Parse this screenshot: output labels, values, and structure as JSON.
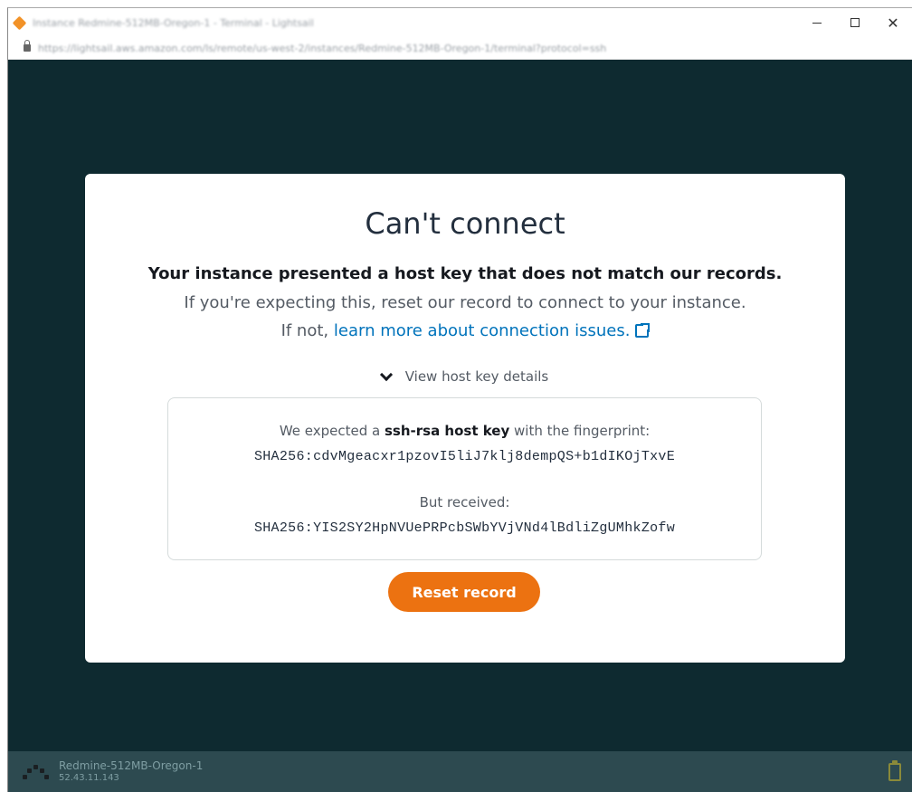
{
  "browser": {
    "title": "Instance Redmine-512MB-Oregon-1 - Terminal - Lightsail",
    "url": "https://lightsail.aws.amazon.com/ls/remote/us-west-2/instances/Redmine-512MB-Oregon-1/terminal?protocol=ssh"
  },
  "window_controls": {
    "minimize": "minimize",
    "maximize": "maximize",
    "close": "✕"
  },
  "dialog": {
    "title": "Can't connect",
    "subtitle": "Your instance presented a host key that does not match our records.",
    "line1": "If you're expecting this, reset our record to connect to your instance.",
    "line2_prefix": "If not,",
    "line2_link": "learn more about connection issues.",
    "toggle_label": "View host key details",
    "expected_prefix": "We expected a",
    "expected_key_type": "ssh-rsa host key",
    "expected_suffix": "with the fingerprint:",
    "expected_fingerprint": "SHA256:cdvMgeacxr1pzovI5liJ7klj8dempQS+b1dIKOjTxvE",
    "received_label": "But received:",
    "received_fingerprint": "SHA256:YIS2SY2HpNVUePRPcbSWbYVjVNd4lBdliZgUMhkZofw",
    "reset_button": "Reset record"
  },
  "statusbar": {
    "instance_name": "Redmine-512MB-Oregon-1",
    "instance_ip": "52.43.11.143"
  },
  "colors": {
    "terminal_bg": "#0e2a30",
    "accent": "#ec7211",
    "link": "#0073bb"
  }
}
